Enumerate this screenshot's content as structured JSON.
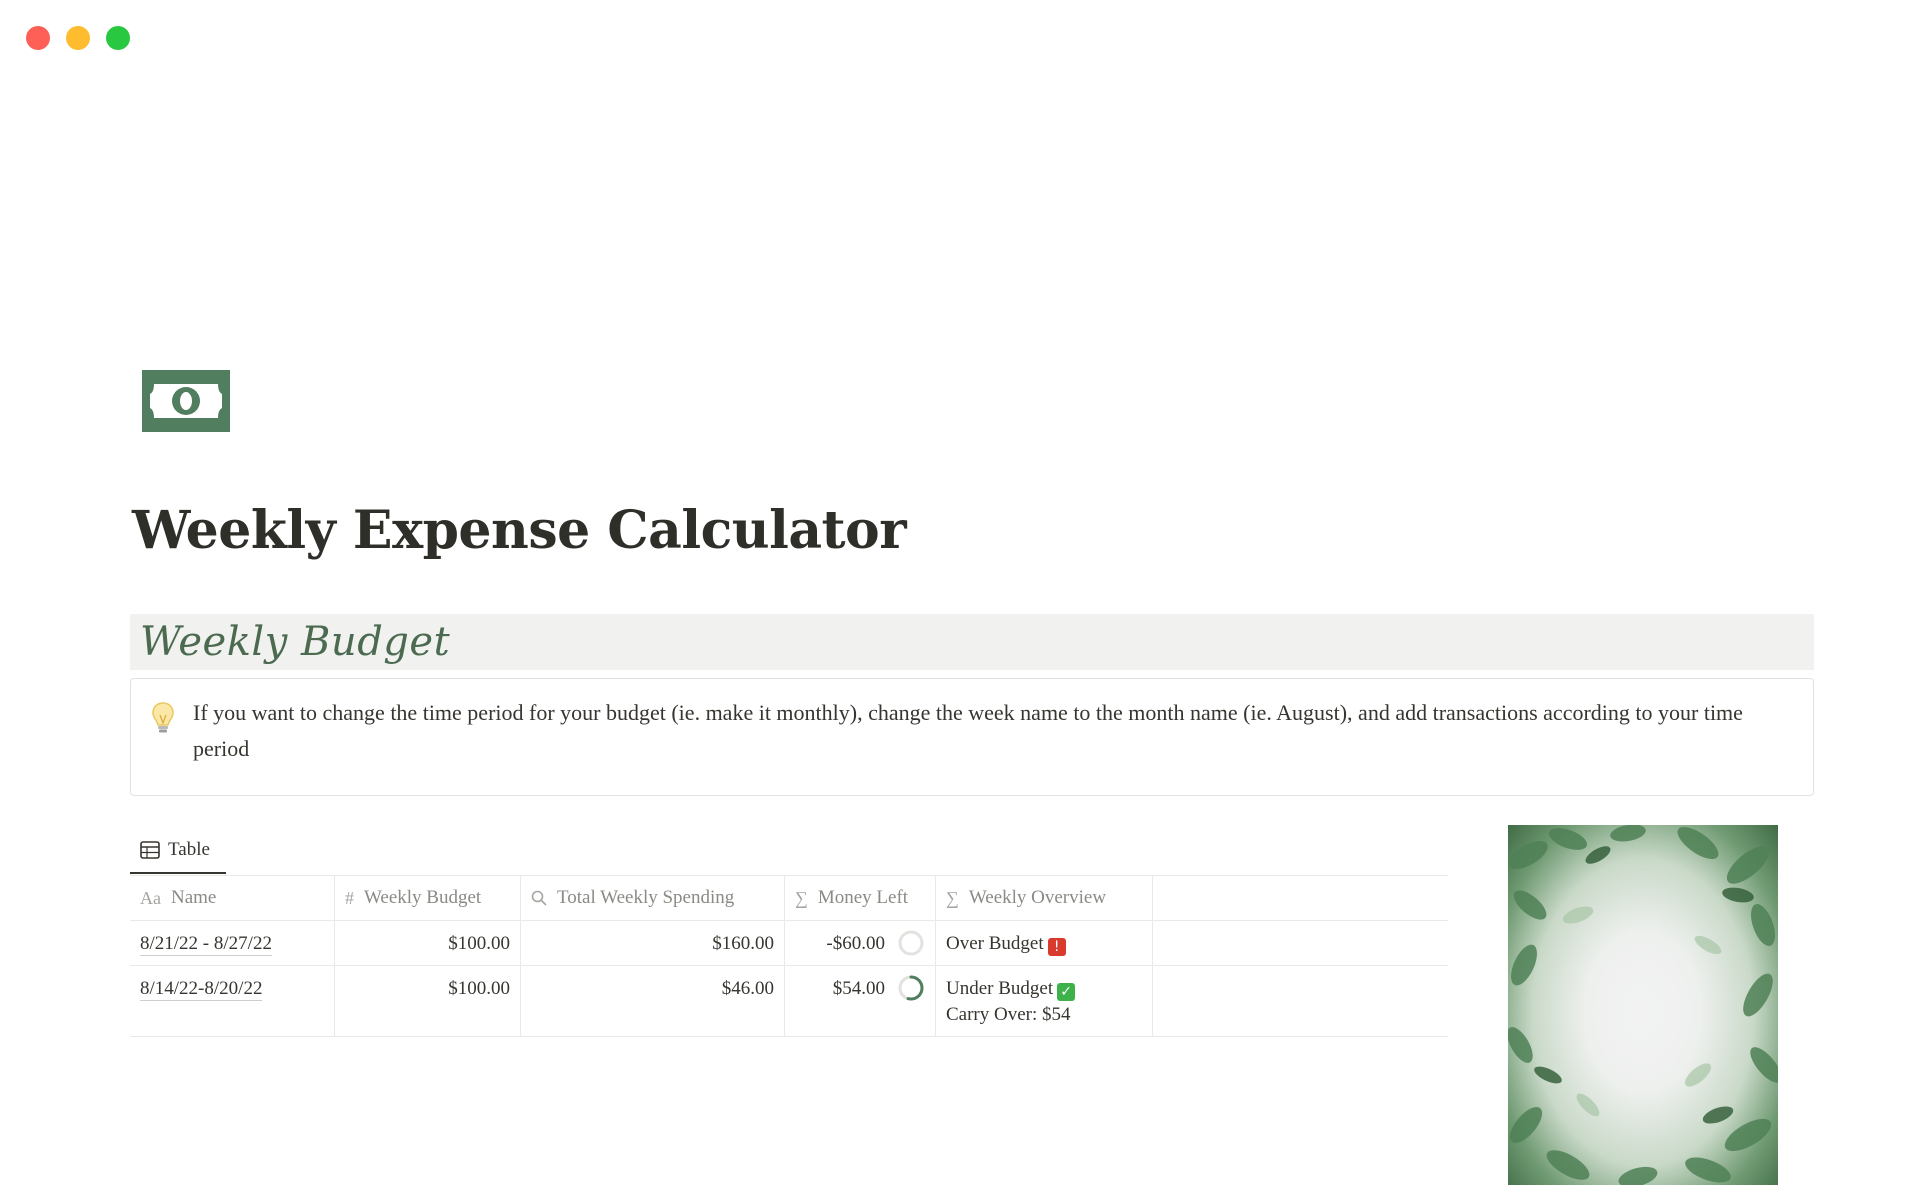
{
  "window": {
    "controls": [
      "close",
      "minimize",
      "zoom"
    ]
  },
  "page": {
    "icon": "banknote-icon",
    "title": "Weekly Expense Calculator"
  },
  "section": {
    "heading": "Weekly Budget"
  },
  "callout": {
    "icon": "lightbulb-icon",
    "text": "If you want to change the time period for your budget (ie. make it monthly), change the week name to the month name (ie. August), and add transactions according to your time period"
  },
  "view": {
    "tab_label": "Table",
    "tab_icon": "table-icon"
  },
  "table": {
    "columns": [
      {
        "label": "Name",
        "icon": "Aa"
      },
      {
        "label": "Weekly Budget",
        "icon": "#"
      },
      {
        "label": "Total Weekly Spending",
        "icon": "search-icon"
      },
      {
        "label": "Money Left",
        "icon": "∑"
      },
      {
        "label": "Weekly Overview",
        "icon": "∑"
      }
    ],
    "rows": [
      {
        "name": "8/21/22 - 8/27/22",
        "weekly_budget": "$100.00",
        "total_spending": "$160.00",
        "money_left": "-$60.00",
        "money_left_fraction": 0,
        "overview_line1": "Over Budget",
        "overview_badge": "siren-icon",
        "overview_line2": ""
      },
      {
        "name": "8/14/22-8/20/22",
        "weekly_budget": "$100.00",
        "total_spending": "$46.00",
        "money_left": "$54.00",
        "money_left_fraction": 0.54,
        "overview_line1": "Under Budget",
        "overview_badge": "check-mark-icon",
        "overview_line2": "Carry Over: $54"
      }
    ]
  },
  "colors": {
    "accent_green": "#4b6a50",
    "icon_green": "#507e5f",
    "ring_track": "#e3e2de",
    "ring_fill": "#507e5f"
  }
}
